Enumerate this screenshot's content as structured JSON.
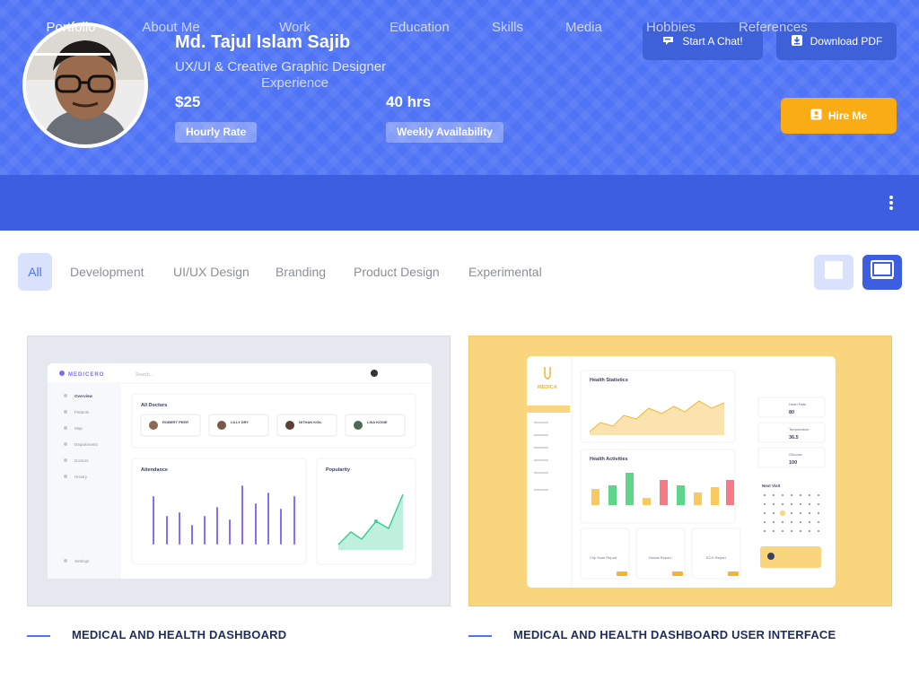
{
  "profile": {
    "name": "Md. Tajul Islam Sajib",
    "role": "UX/UI & Creative Graphic Designer",
    "rate_value": "$25",
    "rate_label": "Hourly Rate",
    "hours_value": "40 hrs",
    "hours_label": "Weekly Availability"
  },
  "actions": {
    "chat_label": "Start A Chat!",
    "pdf_label": "Download PDF",
    "hire_label": "Hire Me"
  },
  "nav": {
    "items": [
      {
        "label": "Portfolio",
        "active": true
      },
      {
        "label": "About Me"
      },
      {
        "label": "Work Experience"
      },
      {
        "label": "Education"
      },
      {
        "label": "Skills"
      },
      {
        "label": "Media"
      },
      {
        "label": "Hobbies"
      },
      {
        "label": "References"
      }
    ]
  },
  "filters": {
    "items": [
      "All",
      "Development",
      "UI/UX Design",
      "Branding",
      "Product Design",
      "Experimental"
    ],
    "active": "All"
  },
  "portfolio": {
    "items": [
      {
        "title": "MEDICAL AND HEALTH DASHBOARD",
        "preview": {
          "brand": "MEDICERO",
          "search": "Search...",
          "menu": [
            "Overview",
            "Patients",
            "Map",
            "Departments",
            "Doctors",
            "History",
            "Settings"
          ],
          "section": "All Doctors",
          "doctors": [
            "ROBERT PEER",
            "LILLY DRY",
            "NITHAN KOIL",
            "LISA KOSIE"
          ],
          "attendance": "Attendance",
          "popularity": "Popularity"
        }
      },
      {
        "title": "MEDICAL AND HEALTH DASHBOARD USER INTERFACE",
        "preview": {
          "brand": "MEDICA",
          "stats_title": "Health Statistics",
          "activities_title": "Health Activities",
          "next_visit": "Next Visit",
          "vitals": [
            "Heart Rate",
            "Temperature",
            "Glucose"
          ],
          "vital_values": [
            "80",
            "36.5",
            "100"
          ],
          "reports": [
            "City Scan Report",
            "Dental Report",
            "ECG Report"
          ]
        }
      }
    ]
  },
  "colors": {
    "hero": "#4f73f5",
    "nav": "#3d5ee1",
    "hire": "#f9ac14",
    "card_yellow": "#f9d57d"
  }
}
